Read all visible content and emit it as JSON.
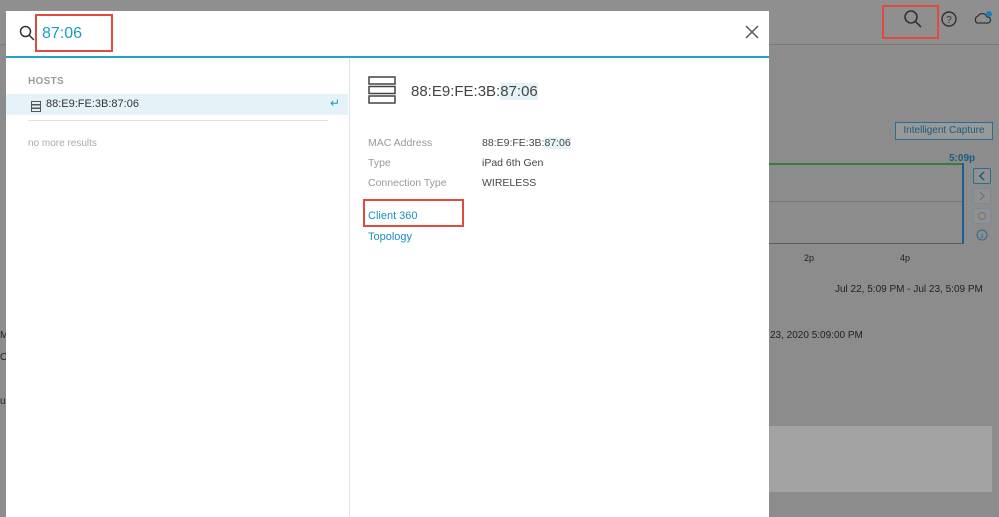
{
  "search": {
    "value": "87:06"
  },
  "results": {
    "section_label": "HOSTS",
    "item_label": "88:E9:FE:3B:87:06",
    "enter_glyph": "↵",
    "no_more": "no more results"
  },
  "detail": {
    "title_prefix": "88:E9:FE:3B:",
    "title_match": "87:06",
    "mac_label": "MAC Address",
    "mac_prefix": "88:E9:FE:3B:",
    "mac_match": "87:06",
    "type_label": "Type",
    "type_value": "iPad 6th Gen",
    "conn_label": "Connection Type",
    "conn_value": "WIRELESS",
    "link_client360": "Client 360",
    "link_topology": "Topology"
  },
  "background": {
    "capture_button": "Intelligent Capture",
    "time_now": "5:09p",
    "tick_2p": "2p",
    "tick_4p": "4p",
    "range": "Jul 22, 5:09 PM - Jul 23, 5:09 PM",
    "timestamp": "23, 2020 5:09:00 PM",
    "edge_m": "M",
    "edge_o": "O",
    "edge_u": "u"
  },
  "colors": {
    "accent": "#1fa3c7",
    "highlight": "#e04b3f",
    "link": "#1a8dc5"
  }
}
